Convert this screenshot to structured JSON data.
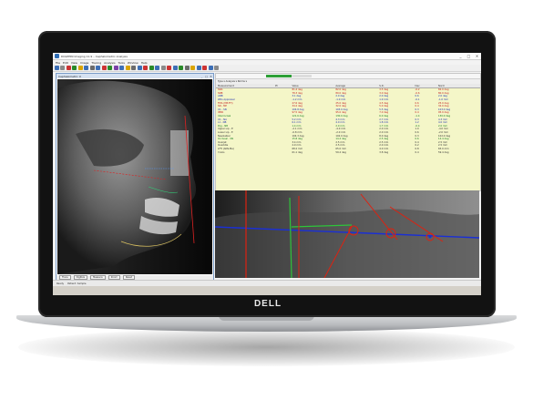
{
  "device": {
    "brand": "DELL"
  },
  "app": {
    "title": "DOLPHIN Imaging 11.9 – Cephalometric Analysis",
    "window_controls": [
      "_",
      "□",
      "✕"
    ]
  },
  "menu": [
    "File",
    "Edit",
    "View",
    "Image",
    "Tracing",
    "Analysis",
    "Tools",
    "Window",
    "Help"
  ],
  "toolbar_colors": [
    "#3d6fb6",
    "#8a8a8a",
    "#c33",
    "#2a8a2a",
    "#d9a400",
    "#3d6fb6",
    "#6b6b6b",
    "#3d6fb6",
    "#c33",
    "#2a8a2a",
    "#7b3fa8",
    "#3d6fb6",
    "#d9a400",
    "#6b6b6b",
    "#3d6fb6",
    "#c33",
    "#2a8a2a",
    "#3d6fb6",
    "#8a8a8a",
    "#c33",
    "#3d6fb6",
    "#2a8a2a",
    "#6b6b6b",
    "#d9a400",
    "#3d6fb6",
    "#c33",
    "#3d6fb6",
    "#8a8a8a"
  ],
  "image_window": {
    "title": "Cephalometric X",
    "status_buttons": [
      "Trace",
      "Digitize",
      "Measure",
      "Zoom",
      "Reset"
    ]
  },
  "table": {
    "progress": 0.55,
    "toolbar_text": "Type ▾   Analysis ▾   Norms ▾",
    "headers": [
      "Measurement",
      "Pt",
      "Value",
      "Average",
      "S.D.",
      "Dev",
      "Norm"
    ],
    "rows": [
      {
        "tone": "red",
        "cells": [
          "SNA",
          "",
          "81.4 deg",
          "82.0 deg",
          "3.5 deg",
          "-0.2",
          "82.0 deg"
        ]
      },
      {
        "tone": "red",
        "cells": [
          "SNB",
          "",
          "78.3 deg",
          "80.0 deg",
          "3.0 deg",
          "-0.6",
          "80.0 deg"
        ]
      },
      {
        "tone": "blue",
        "cells": [
          "ANB",
          "",
          "3.1 deg",
          "2.0 deg",
          "2.0 deg",
          "0.6",
          "2.0 deg"
        ]
      },
      {
        "tone": "blue",
        "cells": [
          "Wits Appraisal",
          "",
          "-1.2 mm",
          "-1.0 mm",
          "1.9 mm",
          "-0.1",
          "-1.0 mm"
        ]
      },
      {
        "tone": "red",
        "cells": [
          "FMA (MP-FH)",
          "",
          "27.6 deg",
          "25.0 deg",
          "4.5 deg",
          "0.6",
          "25.0 deg"
        ]
      },
      {
        "tone": "red",
        "cells": [
          "SN - MP",
          "",
          "34.2 deg",
          "32.0 deg",
          "5.0 deg",
          "0.4",
          "32.0 deg"
        ]
      },
      {
        "tone": "blue",
        "cells": [
          "U1 - SN",
          "",
          "104.8 deg",
          "103.0 deg",
          "5.5 deg",
          "0.3",
          "103.0 deg"
        ]
      },
      {
        "tone": "red",
        "cells": [
          "IMPA",
          "",
          "97.5 deg",
          "95.0 deg",
          "7.0 deg",
          "0.4",
          "95.0 deg"
        ]
      },
      {
        "tone": "green",
        "cells": [
          "Interincisal",
          "",
          "121.6 deg",
          "130.0 deg",
          "6.0 deg",
          "-1.4",
          "130.0 deg"
        ]
      },
      {
        "tone": "blue",
        "cells": [
          "U1 - NA",
          "",
          "5.2 mm",
          "4.3 mm",
          "2.7 mm",
          "0.3",
          "4.3 mm"
        ]
      },
      {
        "tone": "blue",
        "cells": [
          "L1 - NB",
          "",
          "6.1 mm",
          "4.0 mm",
          "1.8 mm",
          "1.2",
          "4.0 mm"
        ]
      },
      {
        "tone": "green",
        "cells": [
          "Pog - NB",
          "",
          "1.4 mm",
          "2.0 mm",
          "1.7 mm",
          "-0.4",
          "2.0 mm"
        ]
      },
      {
        "tone": "dark",
        "cells": [
          "Upper Lip - E",
          "",
          "-2.1 mm",
          "-4.0 mm",
          "2.0 mm",
          "1.0",
          "-4.0 mm"
        ]
      },
      {
        "tone": "dark",
        "cells": [
          "Lower Lip - E",
          "",
          "-0.8 mm",
          "-2.0 mm",
          "2.0 mm",
          "0.6",
          "-2.0 mm"
        ]
      },
      {
        "tone": "dark",
        "cells": [
          "Nasolabial",
          "",
          "104.3 deg",
          "102.0 deg",
          "8.0 deg",
          "0.3",
          "102.0 deg"
        ]
      },
      {
        "tone": "green",
        "cells": [
          "Occlusal - SN",
          "",
          "15.8 deg",
          "14.4 deg",
          "2.5 deg",
          "0.6",
          "14.4 deg"
        ]
      },
      {
        "tone": "dark",
        "cells": [
          "Overjet",
          "",
          "3.4 mm",
          "2.5 mm",
          "2.5 mm",
          "0.4",
          "2.5 mm"
        ]
      },
      {
        "tone": "dark",
        "cells": [
          "Overbite",
          "",
          "2.9 mm",
          "2.5 mm",
          "2.0 mm",
          "0.2",
          "2.5 mm"
        ]
      },
      {
        "tone": "dark",
        "cells": [
          "LFH (ANS-Me)",
          "",
          "68.2 mm",
          "65.0 mm",
          "4.0 mm",
          "0.8",
          "65.0 mm"
        ]
      },
      {
        "tone": "dark",
        "cells": [
          "Y-Axis",
          "",
          "61.1 deg",
          "59.4 deg",
          "3.8 deg",
          "0.4",
          "59.4 deg"
        ]
      }
    ]
  },
  "statusbar": {
    "left": "Ready",
    "right": "Patient: Sample"
  }
}
